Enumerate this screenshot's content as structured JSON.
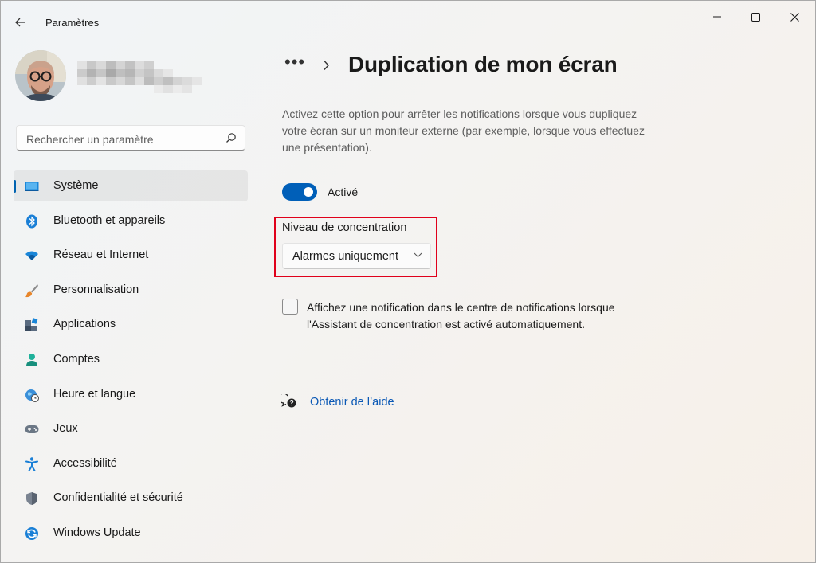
{
  "window": {
    "title": "Paramètres",
    "controls": {
      "minimize_icon": "minimize-icon",
      "maximize_icon": "maximize-icon",
      "close_icon": "close-icon"
    }
  },
  "profile": {
    "avatar_icon": "user-photo-avatar"
  },
  "search": {
    "placeholder": "Rechercher un paramètre",
    "icon": "search-icon"
  },
  "sidebar": {
    "items": [
      {
        "label": "Système",
        "icon": "system-display-icon",
        "selected": true
      },
      {
        "label": "Bluetooth et appareils",
        "icon": "bluetooth-icon"
      },
      {
        "label": "Réseau et Internet",
        "icon": "wifi-icon"
      },
      {
        "label": "Personnalisation",
        "icon": "paintbrush-icon"
      },
      {
        "label": "Applications",
        "icon": "apps-icon"
      },
      {
        "label": "Comptes",
        "icon": "account-icon"
      },
      {
        "label": "Heure et langue",
        "icon": "clock-globe-icon"
      },
      {
        "label": "Jeux",
        "icon": "gamepad-icon"
      },
      {
        "label": "Accessibilité",
        "icon": "accessibility-icon"
      },
      {
        "label": "Confidentialité et sécurité",
        "icon": "shield-icon"
      },
      {
        "label": "Windows Update",
        "icon": "windows-update-icon"
      }
    ]
  },
  "breadcrumb": {
    "more": "•••",
    "title": "Duplication de mon écran"
  },
  "content": {
    "description": "Activez cette option pour arrêter les notifications lorsque vous dupliquez votre écran sur un moniteur externe (par exemple, lorsque vous effectuez une présentation).",
    "toggle": {
      "label": "Activé",
      "on": true
    },
    "focus_level": {
      "label": "Niveau de concentration",
      "value": "Alarmes uniquement"
    },
    "checkbox": {
      "label": "Affichez une notification dans le centre de notifications lorsque l'Assistant de concentration est activé automatiquement.",
      "checked": false
    },
    "help": {
      "label": "Obtenir de l’aide",
      "icon": "help-chat-icon"
    }
  },
  "colors": {
    "accent": "#005fb8",
    "highlight": "#e0001b",
    "link": "#0a58b5"
  }
}
